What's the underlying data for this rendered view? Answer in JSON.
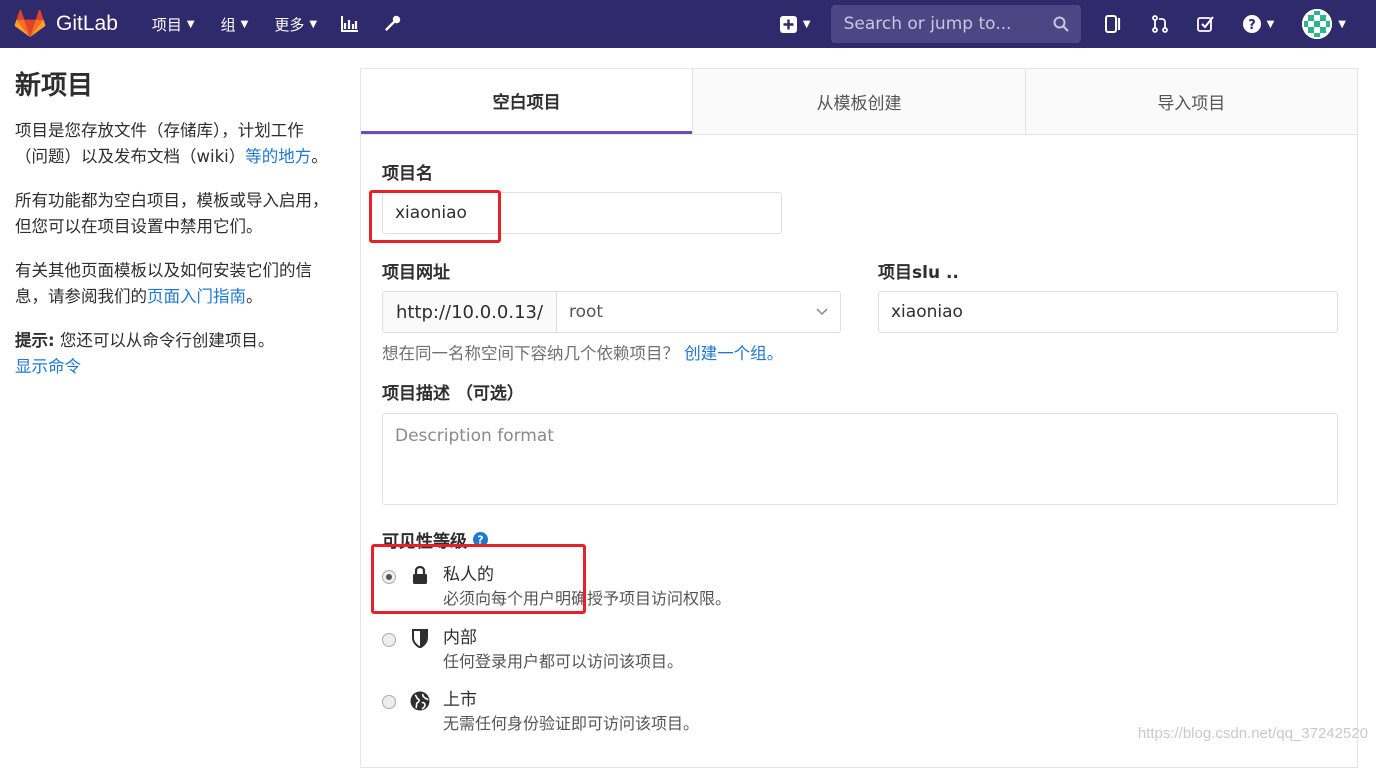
{
  "navbar": {
    "brand": "GitLab",
    "menu": [
      {
        "label": "项目"
      },
      {
        "label": "组"
      },
      {
        "label": "更多"
      }
    ],
    "search_placeholder": "Search or jump to..."
  },
  "sidebar": {
    "title": "新项目",
    "para1_text": "项目是您存放文件（存储库），计划工作（问题）以及发布文档（wiki）",
    "para1_link": "等的地方",
    "para1_end": "。",
    "para2": "所有功能都为空白项目，模板或导入启用，但您可以在项目设置中禁用它们。",
    "para3_text": "有关其他页面模板以及如何安装它们的信息，请参阅我们的",
    "para3_link": "页面入门指南",
    "para3_end": "。",
    "tip_label": "提示:",
    "tip_text": " 您还可以从命令行创建项目。",
    "tip_link": "显示命令"
  },
  "tabs": [
    {
      "label": "空白项目",
      "active": true
    },
    {
      "label": "从模板创建",
      "active": false
    },
    {
      "label": "导入项目",
      "active": false
    }
  ],
  "form": {
    "name_label": "项目名",
    "name_value": "xiaoniao",
    "url_label": "项目网址",
    "url_prefix": "http://10.0.0.13/",
    "namespace_value": "root",
    "slug_label": "项目slu ..",
    "slug_value": "xiaoniao",
    "help_text": "想在同一名称空间下容纳几个依赖项目？",
    "help_link": "创建一个组。",
    "desc_label": "项目描述 （可选）",
    "desc_placeholder": "Description format",
    "visibility_label": "可见性等级",
    "visibility": [
      {
        "title": "私人的",
        "desc": "必须向每个用户明确授予项目访问权限。",
        "checked": true,
        "icon": "lock-icon"
      },
      {
        "title": "内部",
        "desc": "任何登录用户都可以访问该项目。",
        "checked": false,
        "icon": "shield-icon"
      },
      {
        "title": "上市",
        "desc": "无需任何身份验证即可访问该项目。",
        "checked": false,
        "icon": "globe-icon"
      }
    ]
  },
  "watermark": "https://blog.csdn.net/qq_37242520",
  "colors": {
    "navbar": "#2f2a6b",
    "link": "#1f78d1",
    "active_tab": "#6b4fbb",
    "annotation": "#e8202a"
  }
}
